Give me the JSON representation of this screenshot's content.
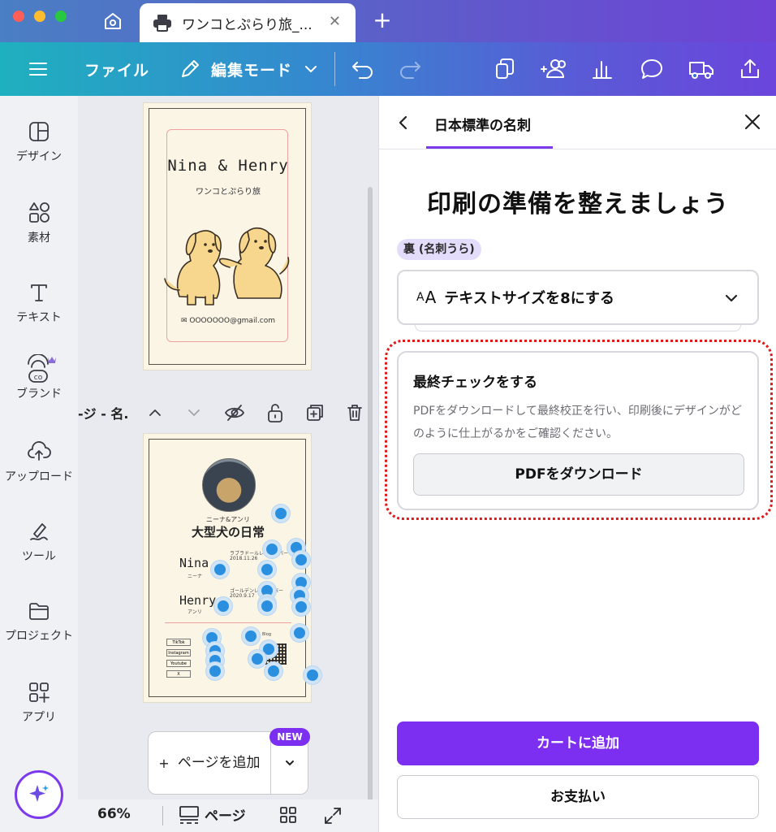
{
  "window": {
    "tab_title": "ワンコとぷらり旅_...",
    "traffic_colors": [
      "#ff5f57",
      "#febc2e",
      "#28c840"
    ]
  },
  "toolbar": {
    "file_label": "ファイル",
    "edit_mode_label": "編集モード"
  },
  "sidebar": {
    "items": [
      {
        "label": "デザイン",
        "icon": "layout-icon"
      },
      {
        "label": "素材",
        "icon": "shapes-icon"
      },
      {
        "label": "テキスト",
        "icon": "text-icon"
      },
      {
        "label": "ブランド",
        "icon": "brand-icon"
      },
      {
        "label": "アップロード",
        "icon": "upload-icon"
      },
      {
        "label": "ツール",
        "icon": "draw-icon"
      },
      {
        "label": "プロジェクト",
        "icon": "folder-icon"
      },
      {
        "label": "アプリ",
        "icon": "apps-icon"
      }
    ]
  },
  "canvas": {
    "page_label": "-ジ - 名.",
    "front_card": {
      "title": "Nina & Henry",
      "subtitle": "ワンコとぷらり旅",
      "email": "✉ OOOOOOO@gmail.com"
    },
    "back_card": {
      "kicker": "ニーナ&アンリ",
      "heading": "大型犬の日常",
      "name1": "Nina",
      "name1_kana": "ニーナ",
      "name1_breed": "ラブラドールレトリーバー",
      "name1_date": "2018.11.26",
      "name2": "Henry",
      "name2_kana": "アンリ",
      "name2_breed": "ゴールデンレトリーバー",
      "name2_date": "2020.9.17",
      "socials": [
        "TikTok",
        "Instagram",
        "Youtube",
        "X"
      ],
      "blog_label": "Blog"
    },
    "add_page_label": "ページを追加",
    "new_badge": "NEW"
  },
  "bottom_bar": {
    "zoom": "66%",
    "pages_label": "ページ"
  },
  "panel": {
    "tab_title": "日本標準の名刺",
    "headline": "印刷の準備を整えましょう",
    "side_badge": "裏 (名刺うら)",
    "accordion_label": "テキストサイズを8にする",
    "check_title": "最終チェックをする",
    "check_desc": "PDFをダウンロードして最終校正を行い、印刷後にデザインがどのように仕上がるかをご確認ください。",
    "pdf_button": "PDFをダウンロード",
    "cart_button": "カートに追加",
    "pay_button": "お支払い",
    "accent_color": "#7c2ff0",
    "highlight_color": "#e01a1a"
  }
}
